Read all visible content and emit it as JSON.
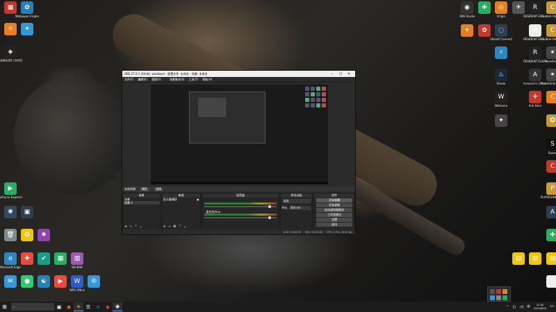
{
  "obs": {
    "title": "OBS 27.0.1 (64-bit, windows) - 配置文件: 未命名 - 场景: 未命名",
    "menu": [
      "文件(F)",
      "编辑(E)",
      "视图(V)",
      "",
      "场景集合(S)",
      "工具(T)",
      "帮助(H)"
    ],
    "context_bar": {
      "label": "未选择源",
      "properties": "属性",
      "filters": "滤镜"
    },
    "docks": {
      "scenes": {
        "header": "场景",
        "items": [
          "场景",
          "场景 2"
        ]
      },
      "sources": {
        "header": "来源",
        "items": [
          "显示器捕获"
        ]
      },
      "mixer": {
        "header": "混音器",
        "tracks": [
          "",
          "麦克风/Aux"
        ]
      },
      "transitions": {
        "header": "转场动画",
        "type": "淡出",
        "duration_label": "时长",
        "duration": "300 ms"
      },
      "controls": {
        "header": "控件",
        "buttons": [
          "开始直播",
          "开始录制",
          "启动虚拟摄像机",
          "工作室模式",
          "设置",
          "退出"
        ]
      }
    },
    "status": [
      "LIVE: 00:00:00",
      "REC: 00:00:00",
      "CPU: 2.3%, 30.00 fps"
    ]
  },
  "desktop_icons": [
    {
      "label": "",
      "color": "#c0392b",
      "glyph": "▦"
    },
    {
      "label": "Wallpaper Engine",
      "color": "#2980b9",
      "glyph": "✿"
    },
    {
      "label": "",
      "color": "#e67e22",
      "glyph": "☼"
    },
    {
      "label": "",
      "color": "#3498db",
      "glyph": "✦"
    },
    {
      "label": "ARMOURY CRATE",
      "color": "#222",
      "glyph": "◈"
    },
    {
      "label": "GeForce Experience",
      "color": "#27ae60",
      "glyph": "▶"
    },
    {
      "label": "",
      "color": "#2c3e50",
      "glyph": "▣"
    },
    {
      "label": "",
      "color": "#34495e",
      "glyph": "✺"
    },
    {
      "label": "",
      "color": "#7f8c8d",
      "glyph": "🗑"
    },
    {
      "label": "",
      "color": "#f1c40f",
      "glyph": "✪"
    },
    {
      "label": "",
      "color": "#8e44ad",
      "glyph": "✸"
    },
    {
      "label": "Microsoft Edge",
      "color": "#2e86c1",
      "glyph": "e"
    },
    {
      "label": "",
      "color": "#e74c3c",
      "glyph": "✚"
    },
    {
      "label": "",
      "color": "#16a085",
      "glyph": "✔"
    },
    {
      "label": "",
      "color": "#27ae60",
      "glyph": "▦"
    },
    {
      "label": "WinRAR",
      "color": "#9b59b6",
      "glyph": "▥"
    },
    {
      "label": "",
      "color": "#3498db",
      "glyph": "✉"
    },
    {
      "label": "",
      "color": "#2ecc71",
      "glyph": "●"
    },
    {
      "label": "",
      "color": "#2980b9",
      "glyph": "☯"
    },
    {
      "label": "",
      "color": "#e74c3c",
      "glyph": "▶"
    },
    {
      "label": "WPS Office",
      "color": "#2c5cc5",
      "glyph": "W"
    },
    {
      "label": "",
      "color": "#3498db",
      "glyph": "✇"
    },
    {
      "label": "OBS Studio",
      "color": "#333",
      "glyph": "◉"
    },
    {
      "label": "",
      "color": "#27ae60",
      "glyph": "✚"
    },
    {
      "label": "Origin",
      "color": "#e67e22",
      "glyph": "◎"
    },
    {
      "label": "",
      "color": "#555",
      "glyph": "✈"
    },
    {
      "label": "RESIDENT EVIL 2",
      "color": "#222",
      "glyph": "R"
    },
    {
      "label": "Counter-Strike: Global Off...",
      "color": "#c49a3a",
      "glyph": "C"
    },
    {
      "label": "",
      "color": "#e67e22",
      "glyph": "✦"
    },
    {
      "label": "",
      "color": "#c0392b",
      "glyph": "✿"
    },
    {
      "label": "Ubisoft Connect",
      "color": "#2c3e50",
      "glyph": "◌"
    },
    {
      "label": "RESIDENT EVIL 3",
      "color": "#eee",
      "glyph": "R"
    },
    {
      "label": "Counter-Strike: Global Off...",
      "color": "#c49a3a",
      "glyph": "C"
    },
    {
      "label": "",
      "color": "#2e86c1",
      "glyph": "⚡"
    },
    {
      "label": "RESIDENT EVIL 3",
      "color": "#222",
      "glyph": "R"
    },
    {
      "label": "PlanetSide 2",
      "color": "#444",
      "glyph": "✶"
    },
    {
      "label": "Steam",
      "color": "#1b2838",
      "glyph": "♨"
    },
    {
      "label": "Assassin's Creed Od...",
      "color": "#333",
      "glyph": "A"
    },
    {
      "label": "PlanetSide 2 - Test",
      "color": "#444",
      "glyph": "✶"
    },
    {
      "label": "WeGame",
      "color": "#222",
      "glyph": "W"
    },
    {
      "label": "Aim Hero",
      "color": "#c0392b",
      "glyph": "✛"
    },
    {
      "label": "",
      "color": "#e67e22",
      "glyph": "C"
    },
    {
      "label": "",
      "color": "#444",
      "glyph": "✦"
    },
    {
      "label": "",
      "color": "#c49a3a",
      "glyph": "✪"
    },
    {
      "label": "Squad",
      "color": "#111",
      "glyph": "S"
    },
    {
      "label": "",
      "color": "#c0392b",
      "glyph": "C"
    },
    {
      "label": "PLAYERUNKNOWN'S BATTLEGR...",
      "color": "#c49a3a",
      "glyph": "P"
    },
    {
      "label": "",
      "color": "#2c3e50",
      "glyph": "A"
    },
    {
      "label": "",
      "color": "#27ae60",
      "glyph": "✚"
    },
    {
      "label": "",
      "color": "#f1c40f",
      "glyph": "▤"
    },
    {
      "label": "",
      "color": "#f1c40f",
      "glyph": "▤"
    },
    {
      "label": "",
      "color": "#f1c40f",
      "glyph": "▤"
    },
    {
      "label": "",
      "color": "#eee",
      "glyph": "▭"
    }
  ],
  "taskbar": {
    "search_placeholder": "",
    "time": "21:50",
    "date": "2021/8/20",
    "apps": [
      "▣",
      "◉",
      "◈",
      "☰",
      "e",
      "◆",
      "◉"
    ]
  }
}
